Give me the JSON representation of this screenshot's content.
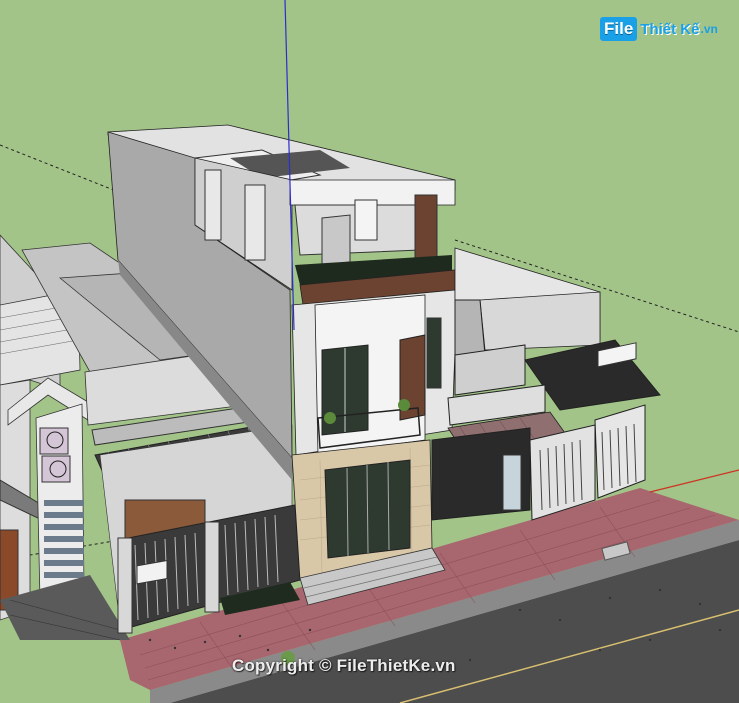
{
  "watermark": {
    "logo_file": "File",
    "logo_rest": "Thiết Kế",
    "logo_tld": ".vn",
    "copyright": "Copyright © FileThietKe.vn"
  },
  "colors": {
    "sky_ground": "#a3c489",
    "wall_white": "#ececec",
    "wall_gray": "#b8b8b8",
    "wall_shadow": "#8e8e8e",
    "wood": "#6b4330",
    "pavement": "#a8666f",
    "road": "#4a4a4a",
    "axis_blue": "#2d2dcc",
    "axis_red": "#cc3322",
    "roof_tile": "#8f6f70",
    "logo_blue": "#1aa0e6"
  }
}
